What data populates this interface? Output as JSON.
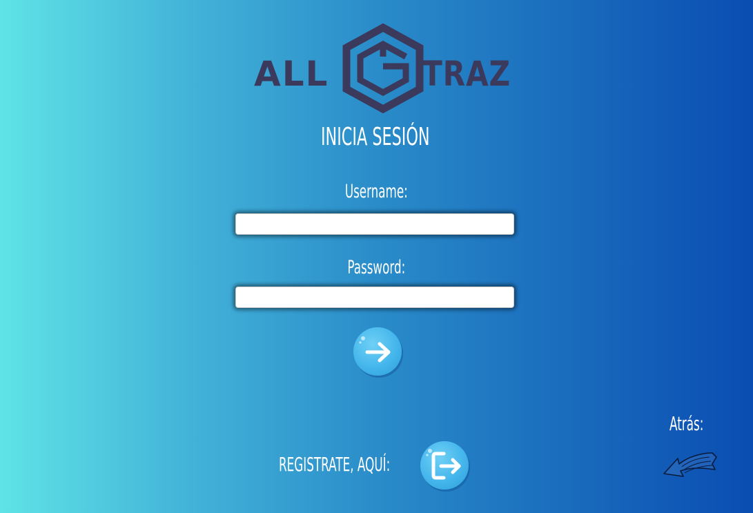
{
  "logo": {
    "text_left": "ALL",
    "text_right": "TRAZ",
    "color": "#3b3a5c"
  },
  "login": {
    "title": "INICIA SESIÓN",
    "username_label": "Username:",
    "username_value": "",
    "password_label": "Password:",
    "password_value": "",
    "submit_icon": "arrow-right-icon"
  },
  "register": {
    "label": "REGISTRATE, AQUÍ:",
    "icon": "exit-door-icon"
  },
  "back": {
    "label": "Atrás:",
    "icon": "curved-arrow-left-icon"
  },
  "colors": {
    "gradient_start": "#5fe3e6",
    "gradient_end": "#0a4db2",
    "button_blue": "#45b6ec"
  }
}
